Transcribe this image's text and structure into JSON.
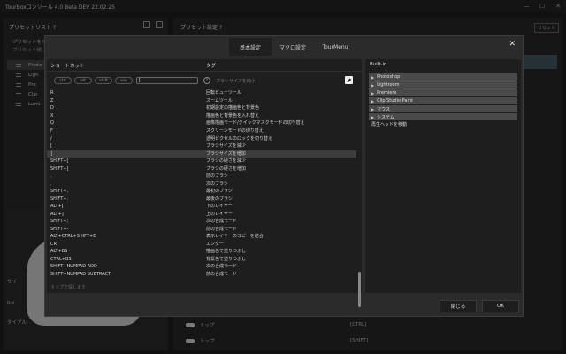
{
  "app": {
    "title": "TourBoxコンソール 4.0 Beta DEV 22.02.25",
    "window_controls": [
      "—",
      "☐",
      "✕"
    ]
  },
  "left_panel": {
    "header": "プリセットリスト ?",
    "text1": "プリセットをオ…",
    "text2": "プリセット説…",
    "items": [
      {
        "label": "Photo"
      },
      {
        "label": "Ligh"
      },
      {
        "label": "Pre"
      },
      {
        "label": "Clip"
      },
      {
        "label": "Lumi"
      }
    ],
    "labels": [
      "サイ",
      "Rol",
      "タイプル"
    ]
  },
  "right_panel": {
    "header": "プリセット設定 ?",
    "reset": "リセット",
    "rows": [
      {
        "name": "トップ",
        "value": "[CTRL]"
      },
      {
        "name": "トップ",
        "value": "[SHIFT]"
      }
    ]
  },
  "modal": {
    "tabs": [
      "基本設定",
      "マクロ設定",
      "TourMenu"
    ],
    "active_tab": 0,
    "close": "✕",
    "shortcut": {
      "col_shortcut": "ショートカット",
      "col_tag": "タグ",
      "modifiers": [
        "ctrl",
        "alt",
        "shift",
        "win"
      ],
      "key_value": "[",
      "help": "?",
      "tag_value": "ブラシサイズを縮小",
      "footer_placeholder": "タップで探します",
      "rows": [
        {
          "key": "R",
          "tag": "回転ビューツール"
        },
        {
          "key": "Z",
          "tag": "ズームツール"
        },
        {
          "key": "D",
          "tag": "初期設定の描画色と背景色"
        },
        {
          "key": "X",
          "tag": "描画色と背景色を入れ替え"
        },
        {
          "key": "Q",
          "tag": "画像描画モード/クイックマスクモードの切り替え",
          "tall": true
        },
        {
          "key": "F",
          "tag": "スクリーンモードの切り替え"
        },
        {
          "key": "/",
          "tag": "透明ピクセルのロックを切り替え"
        },
        {
          "key": "[",
          "tag": "ブラシサイズを減少"
        },
        {
          "key": "]",
          "tag": "ブラシサイズを増加",
          "highlight": true
        },
        {
          "key": "SHIFT+[",
          "tag": "ブラシの硬さを減少"
        },
        {
          "key": "SHIFT+]",
          "tag": "ブラシの硬さを増加"
        },
        {
          "key": ",",
          "tag": "前のブラシ"
        },
        {
          "key": ".",
          "tag": "次のブラシ"
        },
        {
          "key": "SHIFT+,",
          "tag": "最初のブラシ"
        },
        {
          "key": "SHIFT+.",
          "tag": "最後のブラシ"
        },
        {
          "key": "ALT+[",
          "tag": "下のレイヤー"
        },
        {
          "key": "ALT+]",
          "tag": "上のレイヤー"
        },
        {
          "key": "SHIFT+;",
          "tag": "次の合成モード"
        },
        {
          "key": "SHIFT+-",
          "tag": "前の合成モード"
        },
        {
          "key": "ALT+CTRL+SHIFT+E",
          "tag": "表示レイヤーのコピーを結合"
        },
        {
          "key": "CR",
          "tag": "エンター"
        },
        {
          "key": "ALT+BS",
          "tag": "描画色で塗りつぶし"
        },
        {
          "key": "CTRL+BS",
          "tag": "背景色で塗りつぶし"
        },
        {
          "key": "SHIFT+NUMPAD ADD",
          "tag": "次の合成モード"
        },
        {
          "key": "SHIFT+NUMPAD SUBTRACT",
          "tag": "前の合成モード"
        }
      ]
    },
    "builtin": {
      "header": "Built-in",
      "groups": [
        "Photoshop",
        "Lightroom",
        "Premiere",
        "Clip Studio Paint",
        "マウス",
        "システム"
      ],
      "plain_item": "再生ヘッドを移動"
    },
    "buttons": {
      "close": "閉じる",
      "ok": "OK"
    }
  }
}
